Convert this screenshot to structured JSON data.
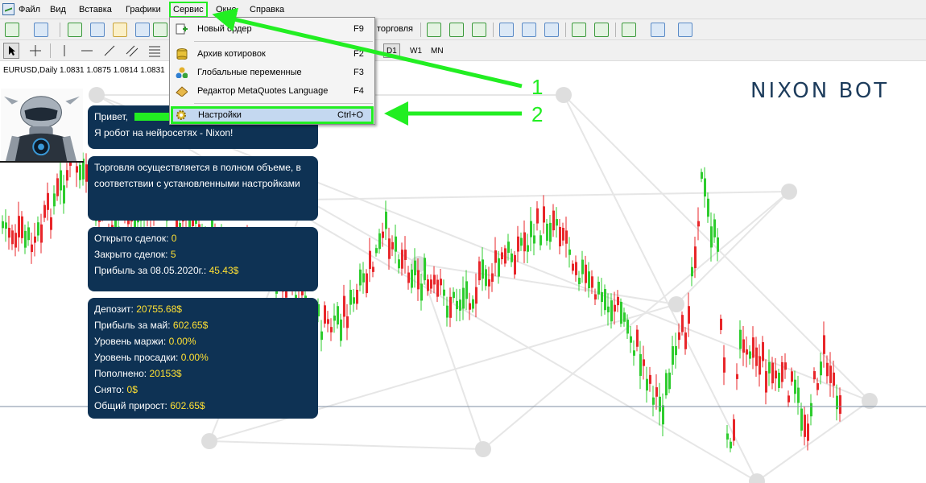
{
  "menubar": {
    "items": [
      "Файл",
      "Вид",
      "Вставка",
      "Графики",
      "Сервис",
      "Окно",
      "Справка"
    ]
  },
  "toolbar": {
    "trading_label": "торговля",
    "timeframes": [
      "D1",
      "W1",
      "MN"
    ]
  },
  "chart": {
    "symbol_info": "EURUSD,Daily  1.0831 1.0875 1.0814 1.0831",
    "brand": "NIXON BOT",
    "colors": {
      "bull": "#2ecc2e",
      "bear": "#e8262a",
      "panel": "#0e3254",
      "value": "#ffe033"
    }
  },
  "panels": {
    "greeting": {
      "line1": "Привет,",
      "line2": "Я робот на нейросетях - Nixon!"
    },
    "trading": {
      "text": "Торговля осуществляется в полном объеме, в соответствии с установленными настройками"
    },
    "deals": {
      "opened_label": "Открыто сделок:",
      "opened_value": "0",
      "closed_label": "Закрыто сделок:",
      "closed_value": "5",
      "profit_label": "Прибыль за 08.05.2020г.:",
      "profit_value": "45.43$"
    },
    "account": {
      "deposit_label": "Депозит:",
      "deposit_value": "20755.68$",
      "month_profit_label": "Прибыль за май:",
      "month_profit_value": "602.65$",
      "margin_label": "Уровень маржи:",
      "margin_value": "0.00%",
      "drawdown_label": "Уровень просадки:",
      "drawdown_value": "0.00%",
      "topup_label": "Пополнено:",
      "topup_value": "20153$",
      "withdrawn_label": "Снято:",
      "withdrawn_value": "0$",
      "total_label": "Общий прирост:",
      "total_value": "602.65$"
    }
  },
  "dropdown": {
    "items": [
      {
        "label": "Новый ордер",
        "shortcut": "F9",
        "icon": "new-order-icon"
      },
      {
        "label": "Архив котировок",
        "shortcut": "F2",
        "icon": "quotes-archive-icon"
      },
      {
        "label": "Глобальные переменные",
        "shortcut": "F3",
        "icon": "global-variables-icon"
      },
      {
        "label": "Редактор MetaQuotes Language",
        "shortcut": "F4",
        "icon": "metaeditor-icon"
      },
      {
        "label": "Настройки",
        "shortcut": "Ctrl+O",
        "icon": "settings-gear-icon"
      }
    ]
  },
  "annotations": {
    "marker1": "1",
    "marker2": "2"
  }
}
